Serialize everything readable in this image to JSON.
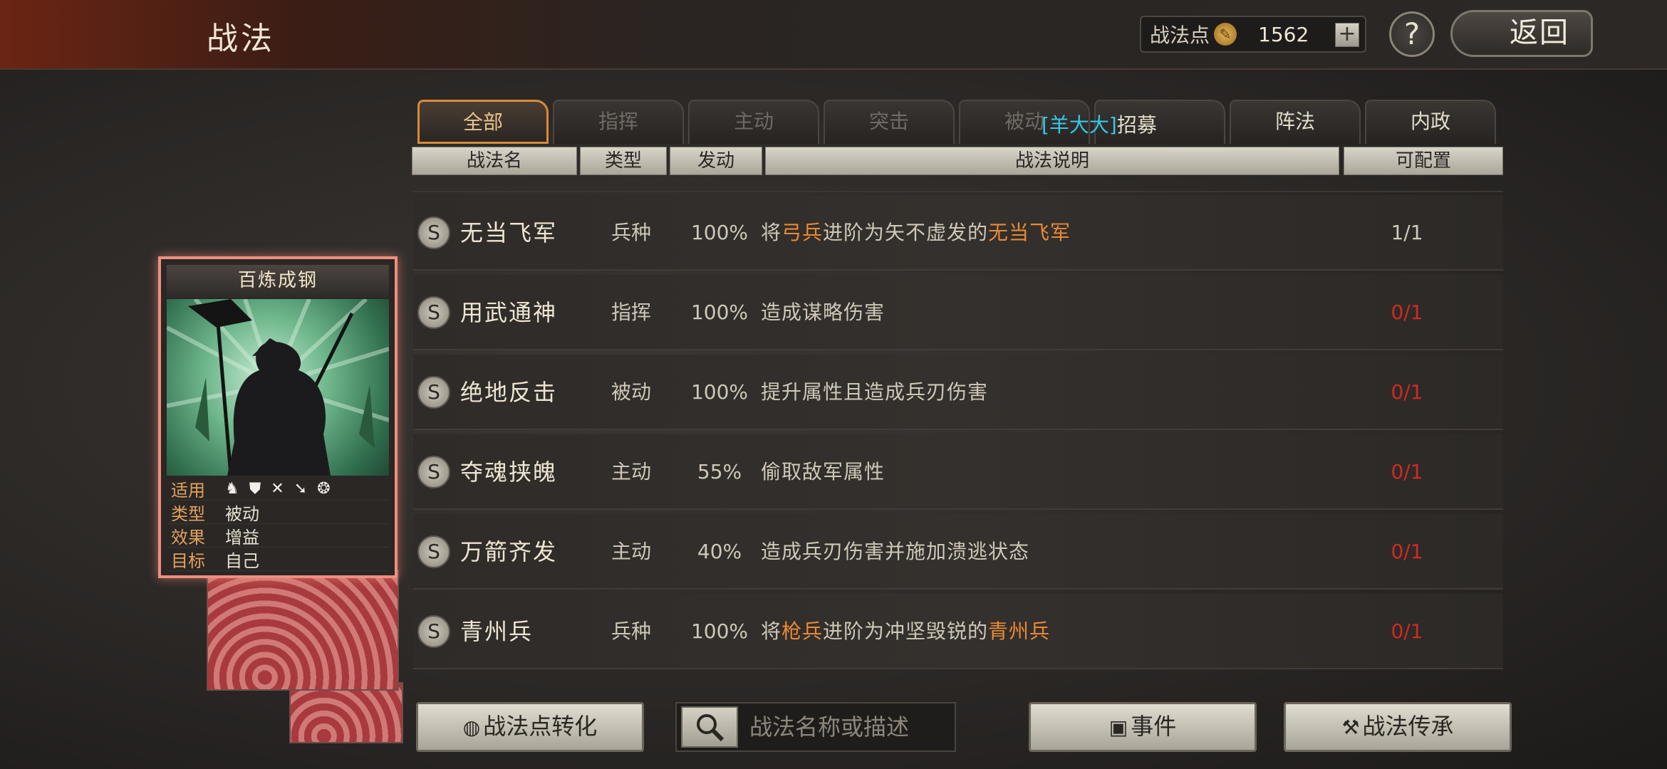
{
  "header": {
    "title": "战法",
    "points_label": "战法点",
    "points_value": "1562",
    "plus_label": "+",
    "help_label": "?",
    "back_label": "返回"
  },
  "tabs": [
    {
      "label": "全部",
      "active": true
    },
    {
      "label": "指挥"
    },
    {
      "label": "主动"
    },
    {
      "label": "突击"
    },
    {
      "label": "被动"
    },
    {
      "label": ""
    },
    {
      "label": "阵法"
    },
    {
      "label": "内政"
    }
  ],
  "tab_overlay": {
    "prefix": "[羊大大]",
    "suffix": "招募"
  },
  "columns": {
    "name": "战法名",
    "type": "类型",
    "trigger": "发动",
    "description": "战法说明",
    "configurable": "可配置"
  },
  "rows": [
    {
      "grade": "S",
      "name": "无当飞军",
      "type": "兵种",
      "rate": "100%",
      "desc_parts": [
        "将",
        "弓兵",
        "进阶为矢不虚发的",
        "无当飞军"
      ],
      "config": "1/1",
      "config_color": "#e8e1d1"
    },
    {
      "grade": "S",
      "name": "用武通神",
      "type": "指挥",
      "rate": "100%",
      "desc": "造成谋略伤害",
      "config": "0/1",
      "config_color": "#d02a20"
    },
    {
      "grade": "S",
      "name": "绝地反击",
      "type": "被动",
      "rate": "100%",
      "desc": "提升属性且造成兵刃伤害",
      "config": "0/1",
      "config_color": "#d02a20"
    },
    {
      "grade": "S",
      "name": "夺魂挟魄",
      "type": "主动",
      "rate": "55%",
      "desc": "偷取敌军属性",
      "config": "0/1",
      "config_color": "#d02a20"
    },
    {
      "grade": "S",
      "name": "万箭齐发",
      "type": "主动",
      "rate": "40%",
      "desc": "造成兵刃伤害并施加溃逃状态",
      "config": "0/1",
      "config_color": "#d02a20"
    },
    {
      "grade": "S",
      "name": "青州兵",
      "type": "兵种",
      "rate": "100%",
      "desc_parts": [
        "将",
        "枪兵",
        "进阶为冲坚毁锐的",
        "青州兵"
      ],
      "config": "0/1",
      "config_color": "#d02a20"
    }
  ],
  "card": {
    "title": "百炼成钢",
    "applies_label": "适用",
    "type_label": "类型",
    "type_value": "被动",
    "effect_label": "效果",
    "effect_value": "增益",
    "target_label": "目标",
    "target_value": "自己",
    "unit_icons": [
      "cavalry-icon",
      "shield-icon",
      "bow-icon",
      "spear-icon",
      "wheel-icon"
    ]
  },
  "bottom": {
    "convert_label": "战法点转化",
    "search_placeholder": "战法名称或描述",
    "event_label": "事件",
    "inherit_label": "战法传承"
  },
  "colors": {
    "accent": "#e98a35",
    "red": "#d02a20",
    "cyan": "#35c8e8",
    "card_border": "#ee8f7e"
  }
}
